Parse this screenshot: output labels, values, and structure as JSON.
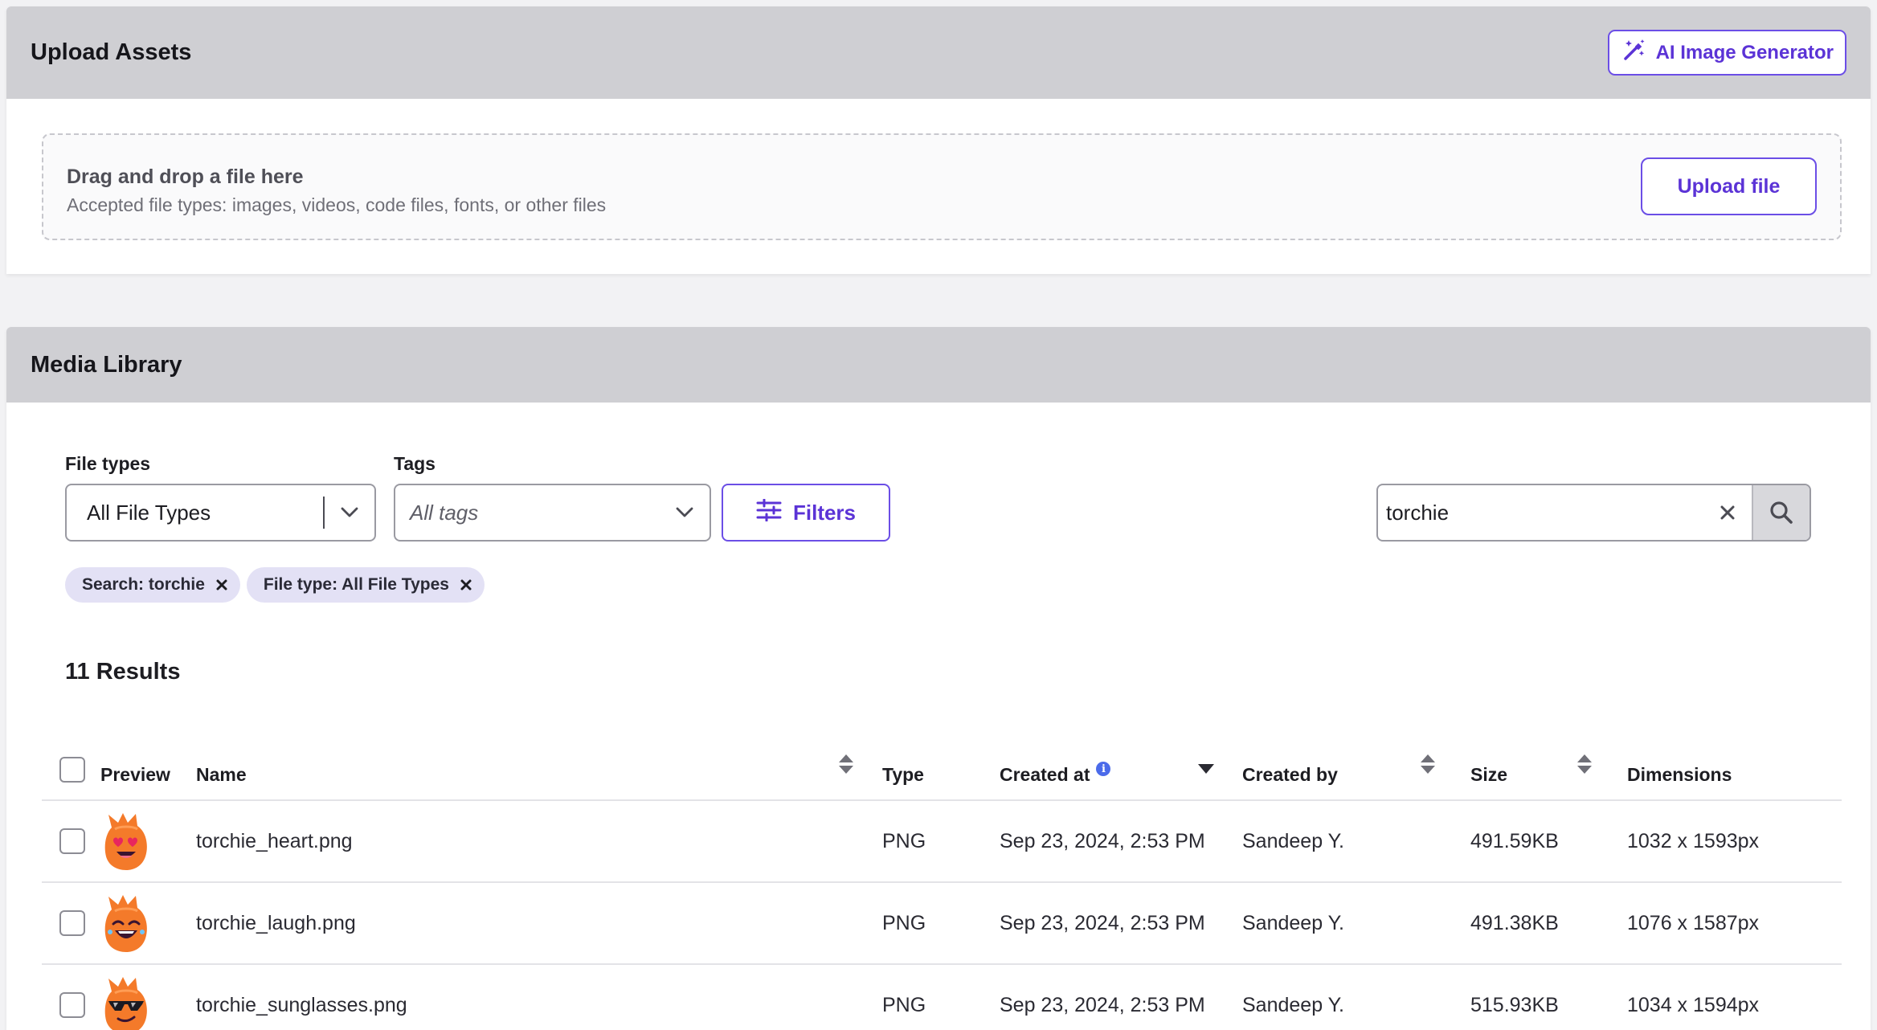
{
  "upload": {
    "title": "Upload Assets",
    "ai_button_label": "AI Image Generator",
    "drop_title": "Drag and drop a file here",
    "drop_subtitle": "Accepted file types: images, videos, code files, fonts, or other files",
    "upload_button_label": "Upload file"
  },
  "media": {
    "title": "Media Library",
    "file_types_label": "File types",
    "file_types_value": "All File Types",
    "tags_label": "Tags",
    "tags_placeholder": "All tags",
    "filters_label": "Filters",
    "search_value": "torchie",
    "chips": [
      "Search: torchie",
      "File type: All File Types"
    ],
    "results_count": "11 Results",
    "columns": {
      "preview": "Preview",
      "name": "Name",
      "type": "Type",
      "created_at": "Created at",
      "created_by": "Created by",
      "size": "Size",
      "dimensions": "Dimensions"
    },
    "rows": [
      {
        "name": "torchie_heart.png",
        "type": "PNG",
        "created_at": "Sep 23, 2024, 2:53 PM",
        "created_by": "Sandeep Y.",
        "size": "491.59KB",
        "dimensions": "1032 x 1593px",
        "preview_icon": "torchie-heart-eyes-icon"
      },
      {
        "name": "torchie_laugh.png",
        "type": "PNG",
        "created_at": "Sep 23, 2024, 2:53 PM",
        "created_by": "Sandeep Y.",
        "size": "491.38KB",
        "dimensions": "1076 x 1587px",
        "preview_icon": "torchie-laugh-icon"
      },
      {
        "name": "torchie_sunglasses.png",
        "type": "PNG",
        "created_at": "Sep 23, 2024, 2:53 PM",
        "created_by": "Sandeep Y.",
        "size": "515.93KB",
        "dimensions": "1034 x 1594px",
        "preview_icon": "torchie-sunglasses-icon"
      }
    ]
  },
  "colors": {
    "accent": "#5b33d6",
    "header_bg": "#cfcfd3",
    "chip_bg": "#e3e1f5",
    "mascot": "#f47a2a"
  }
}
